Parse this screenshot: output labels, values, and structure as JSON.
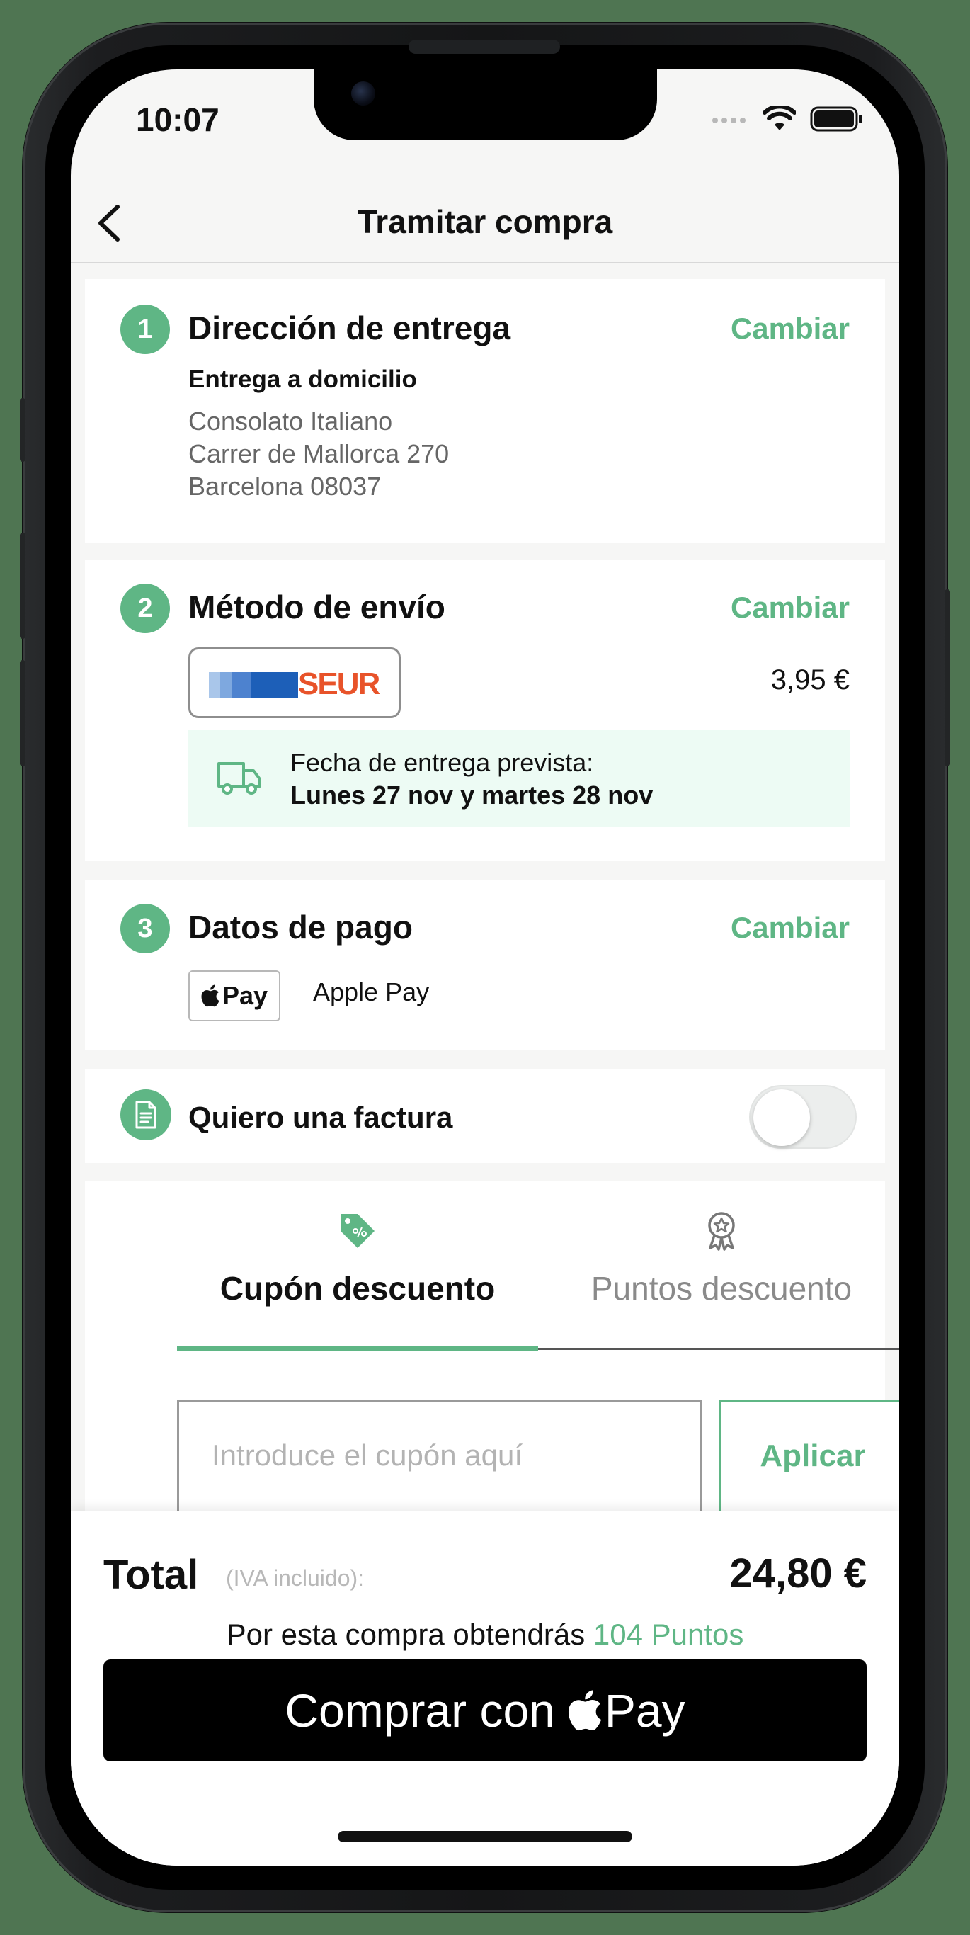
{
  "status_bar": {
    "time": "10:07"
  },
  "nav": {
    "title": "Tramitar compra"
  },
  "colors": {
    "accent": "#5fb685",
    "delivery_bg": "#edfbf4",
    "seur_brand": "#e8532a"
  },
  "delivery_address": {
    "step": "1",
    "title": "Dirección de entrega",
    "change_label": "Cambiar",
    "type": "Entrega a domicilio",
    "lines": [
      "Consolato Italiano",
      "Carrer de Mallorca 270",
      "Barcelona 08037"
    ]
  },
  "shipping": {
    "step": "2",
    "title": "Método de envío",
    "change_label": "Cambiar",
    "carrier": "SEUR",
    "price": "3,95 €",
    "estimate_label": "Fecha de entrega prevista:",
    "estimate_dates": "Lunes 27 nov y martes 28 nov"
  },
  "payment": {
    "step": "3",
    "title": "Datos de pago",
    "change_label": "Cambiar",
    "badge_text": "Pay",
    "method_name": "Apple Pay"
  },
  "invoice": {
    "label": "Quiero una factura",
    "enabled": false
  },
  "discount": {
    "tabs": [
      {
        "label": "Cupón descuento",
        "active": true,
        "icon": "tag-percent-icon"
      },
      {
        "label": "Puntos descuento",
        "active": false,
        "icon": "award-badge-icon"
      }
    ],
    "coupon_placeholder": "Introduce el cupón aquí",
    "apply_label": "Aplicar"
  },
  "summary": {
    "total_label": "Total",
    "tax_note": "(IVA incluido):",
    "total_amount": "24,80 €",
    "points_prefix": "Por esta compra obtendrás",
    "points_value": "104 Puntos",
    "buy_label": "Comprar con",
    "buy_pay_text": "Pay"
  }
}
